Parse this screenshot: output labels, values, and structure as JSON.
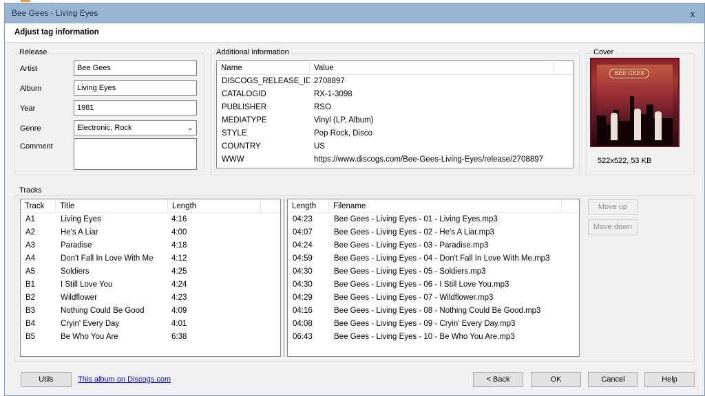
{
  "window": {
    "title": "Bee Gees - Living Eyes",
    "close_label": "x"
  },
  "header": {
    "title": "Adjust tag information"
  },
  "release": {
    "group_label": "Release",
    "fields": [
      {
        "label": "Artist",
        "value": "Bee Gees"
      },
      {
        "label": "Album",
        "value": "Living Eyes"
      },
      {
        "label": "Year",
        "value": "1981"
      },
      {
        "label": "Genre",
        "value": "Electronic, Rock"
      },
      {
        "label": "Comment",
        "value": ""
      }
    ]
  },
  "additional": {
    "group_label": "Additional information",
    "columns": [
      "Name",
      "Value"
    ],
    "rows": [
      [
        "DISCOGS_RELEASE_ID",
        "2708897"
      ],
      [
        "CATALOGID",
        "RX-1-3098"
      ],
      [
        "PUBLISHER",
        "RSO"
      ],
      [
        "MEDIATYPE",
        "Vinyl (LP, Album)"
      ],
      [
        "STYLE",
        "Pop Rock, Disco"
      ],
      [
        "COUNTRY",
        "US"
      ],
      [
        "WWW",
        "https://www.discogs.com/Bee-Gees-Living-Eyes/release/2708897"
      ]
    ]
  },
  "cover": {
    "group_label": "Cover",
    "logo_text": "BEE GEES",
    "size_text": "522x522, 53 KB"
  },
  "tracks": {
    "group_label": "Tracks",
    "columns": [
      "Track",
      "Title",
      "Length"
    ],
    "rows": [
      [
        "A1",
        "Living Eyes",
        "4:16"
      ],
      [
        "A2",
        "He's A Liar",
        "4:00"
      ],
      [
        "A3",
        "Paradise",
        "4:18"
      ],
      [
        "A4",
        "Don't Fall In Love With Me",
        "4:12"
      ],
      [
        "A5",
        "Soldiers",
        "4:25"
      ],
      [
        "B1",
        "I Still Love You",
        "4:24"
      ],
      [
        "B2",
        "Wildflower",
        "4:23"
      ],
      [
        "B3",
        "Nothing Could Be Good",
        "4:09"
      ],
      [
        "B4",
        "Cryin' Every Day",
        "4:01"
      ],
      [
        "B5",
        "Be Who You Are",
        "6:38"
      ]
    ]
  },
  "files": {
    "columns": [
      "Length",
      "Filename"
    ],
    "rows": [
      [
        "04:23",
        "Bee Gees - Living Eyes - 01 - Living Eyes.mp3"
      ],
      [
        "04:07",
        "Bee Gees - Living Eyes - 02 - He's A Liar.mp3"
      ],
      [
        "04:24",
        "Bee Gees - Living Eyes - 03 - Paradise.mp3"
      ],
      [
        "04:59",
        "Bee Gees - Living Eyes - 04 - Don't Fall In Love With Me.mp3"
      ],
      [
        "04:30",
        "Bee Gees - Living Eyes - 05 - Soldiers.mp3"
      ],
      [
        "04:30",
        "Bee Gees - Living Eyes - 06 - I Still Love You.mp3"
      ],
      [
        "04:29",
        "Bee Gees - Living Eyes - 07 - Wildflower.mp3"
      ],
      [
        "04:16",
        "Bee Gees - Living Eyes - 08 - Nothing Could Be Good.mp3"
      ],
      [
        "04:08",
        "Bee Gees - Living Eyes - 09 - Cryin' Every Day.mp3"
      ],
      [
        "06:43",
        "Bee Gees - Living Eyes - 10 - Be Who You Are.mp3"
      ]
    ]
  },
  "buttons": {
    "move_up": "Move up",
    "move_down": "Move down",
    "utils": "Utils",
    "discogs_link": "This album on Discogs.com",
    "back": "< Back",
    "ok": "OK",
    "cancel": "Cancel",
    "help": "Help"
  }
}
